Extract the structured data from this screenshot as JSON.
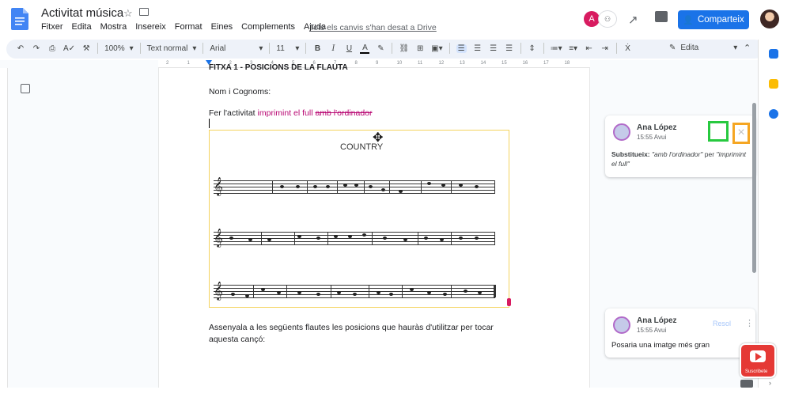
{
  "header": {
    "title": "Activitat música",
    "menus": [
      "Fitxer",
      "Edita",
      "Mostra",
      "Insereix",
      "Format",
      "Eines",
      "Complements",
      "Ajuda"
    ],
    "saved_message": "Tots els canvis s'han desat a Drive",
    "avatar_letter": "A",
    "share_label": "Comparteix"
  },
  "toolbar": {
    "zoom": "100%",
    "style": "Text normal",
    "font": "Arial",
    "font_size": "11",
    "mode": "Edita"
  },
  "ruler": {
    "ticks": [
      "2",
      "1",
      "1",
      "2",
      "3",
      "4",
      "5",
      "6",
      "7",
      "8",
      "9",
      "10",
      "11",
      "12",
      "13",
      "14",
      "15",
      "16",
      "17",
      "18"
    ]
  },
  "document": {
    "heading_partial": "FITXA 1 - POSICIONS DE LA FLAUTA",
    "name_line": "Nom i Cognoms:",
    "activity_prefix": "Fer l'activitat ",
    "inserted_text": "imprimint el full",
    "deleted_text": "amb l'ordinador",
    "image_title": "COUNTRY",
    "paragraph": "Assenyala a les següents flautes les posicions que hauràs d'utilitzar per tocar aquesta cançó:"
  },
  "comments": [
    {
      "author": "Ana López",
      "time": "15:55 Avui",
      "label": "Substitueix:",
      "old": "\"amb l'ordinador\"",
      "connector": "per",
      "new": "\"imprimint el full\""
    },
    {
      "author": "Ana López",
      "time": "15:55 Avui",
      "action": "Resol",
      "text": "Posaria una imatge més gran"
    }
  ],
  "overlay": {
    "subscribe_label": "Suscribete"
  },
  "colors": {
    "accent": "#1a73e8",
    "suggestion": "#b80672",
    "accept_highlight": "#27c93f",
    "reject_highlight": "#f5a623",
    "youtube": "#e53935"
  }
}
